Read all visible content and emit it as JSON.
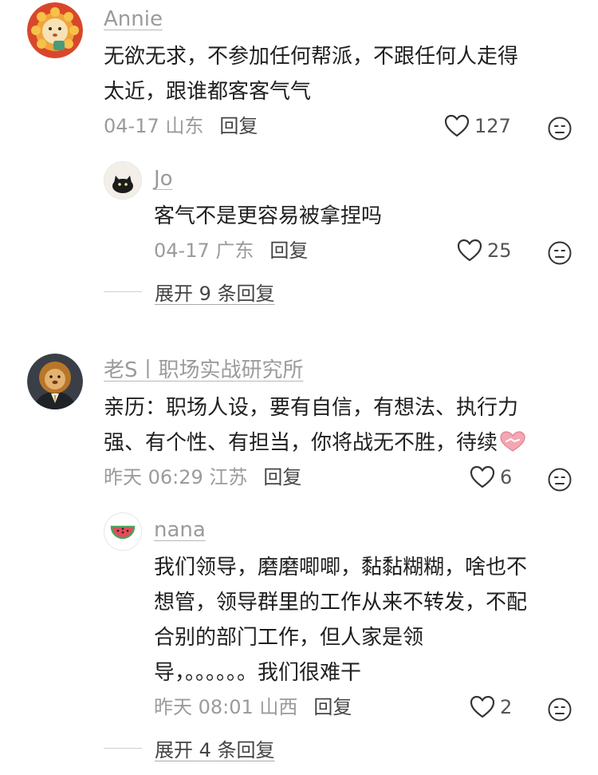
{
  "comments": [
    {
      "username": "Annie",
      "avatar_icon": "sun-lion-avatar",
      "lines": [
        "无欲无求，不参加任何帮派，不跟任何人走得",
        "太近，跟谁都客客气气"
      ],
      "meta": "04-17 山东",
      "reply_label": "回复",
      "likes": "127",
      "reply": {
        "username": "Jo",
        "avatar_icon": "black-cat-avatar",
        "lines": [
          "客气不是更容易被拿捏吗"
        ],
        "meta": "04-17 广东",
        "reply_label": "回复",
        "likes": "25"
      },
      "expand_label": "展开 9 条回复"
    },
    {
      "username": "老S丨职场实战研究所",
      "avatar_icon": "lion-in-suit-avatar",
      "lines": [
        "亲历：职场人设，要有自信，有想法、执行力",
        "强、有个性、有担当，你将战无不胜，待续"
      ],
      "trailing_emoji": "handshake-heart-emoji",
      "meta": "昨天 06:29 江苏",
      "reply_label": "回复",
      "likes": "6",
      "reply": {
        "username": "nana",
        "avatar_icon": "watermelon-avatar",
        "lines": [
          "我们领导，磨磨唧唧，黏黏糊糊，啥也不",
          "想管，领导群里的工作从来不转发，不配",
          "合别的部门工作，但人家是领",
          "导，。。。。。。我们很难干"
        ],
        "meta": "昨天 08:01 山西",
        "reply_label": "回复",
        "likes": "2"
      },
      "expand_label": "展开 4 条回复"
    }
  ],
  "icons": {
    "like": "heart-outline-icon",
    "dislike": "neutral-face-icon"
  },
  "colors": {
    "meta_gray": "#9b9b9b",
    "text": "#1f1f1f",
    "link_dark": "#444444"
  }
}
